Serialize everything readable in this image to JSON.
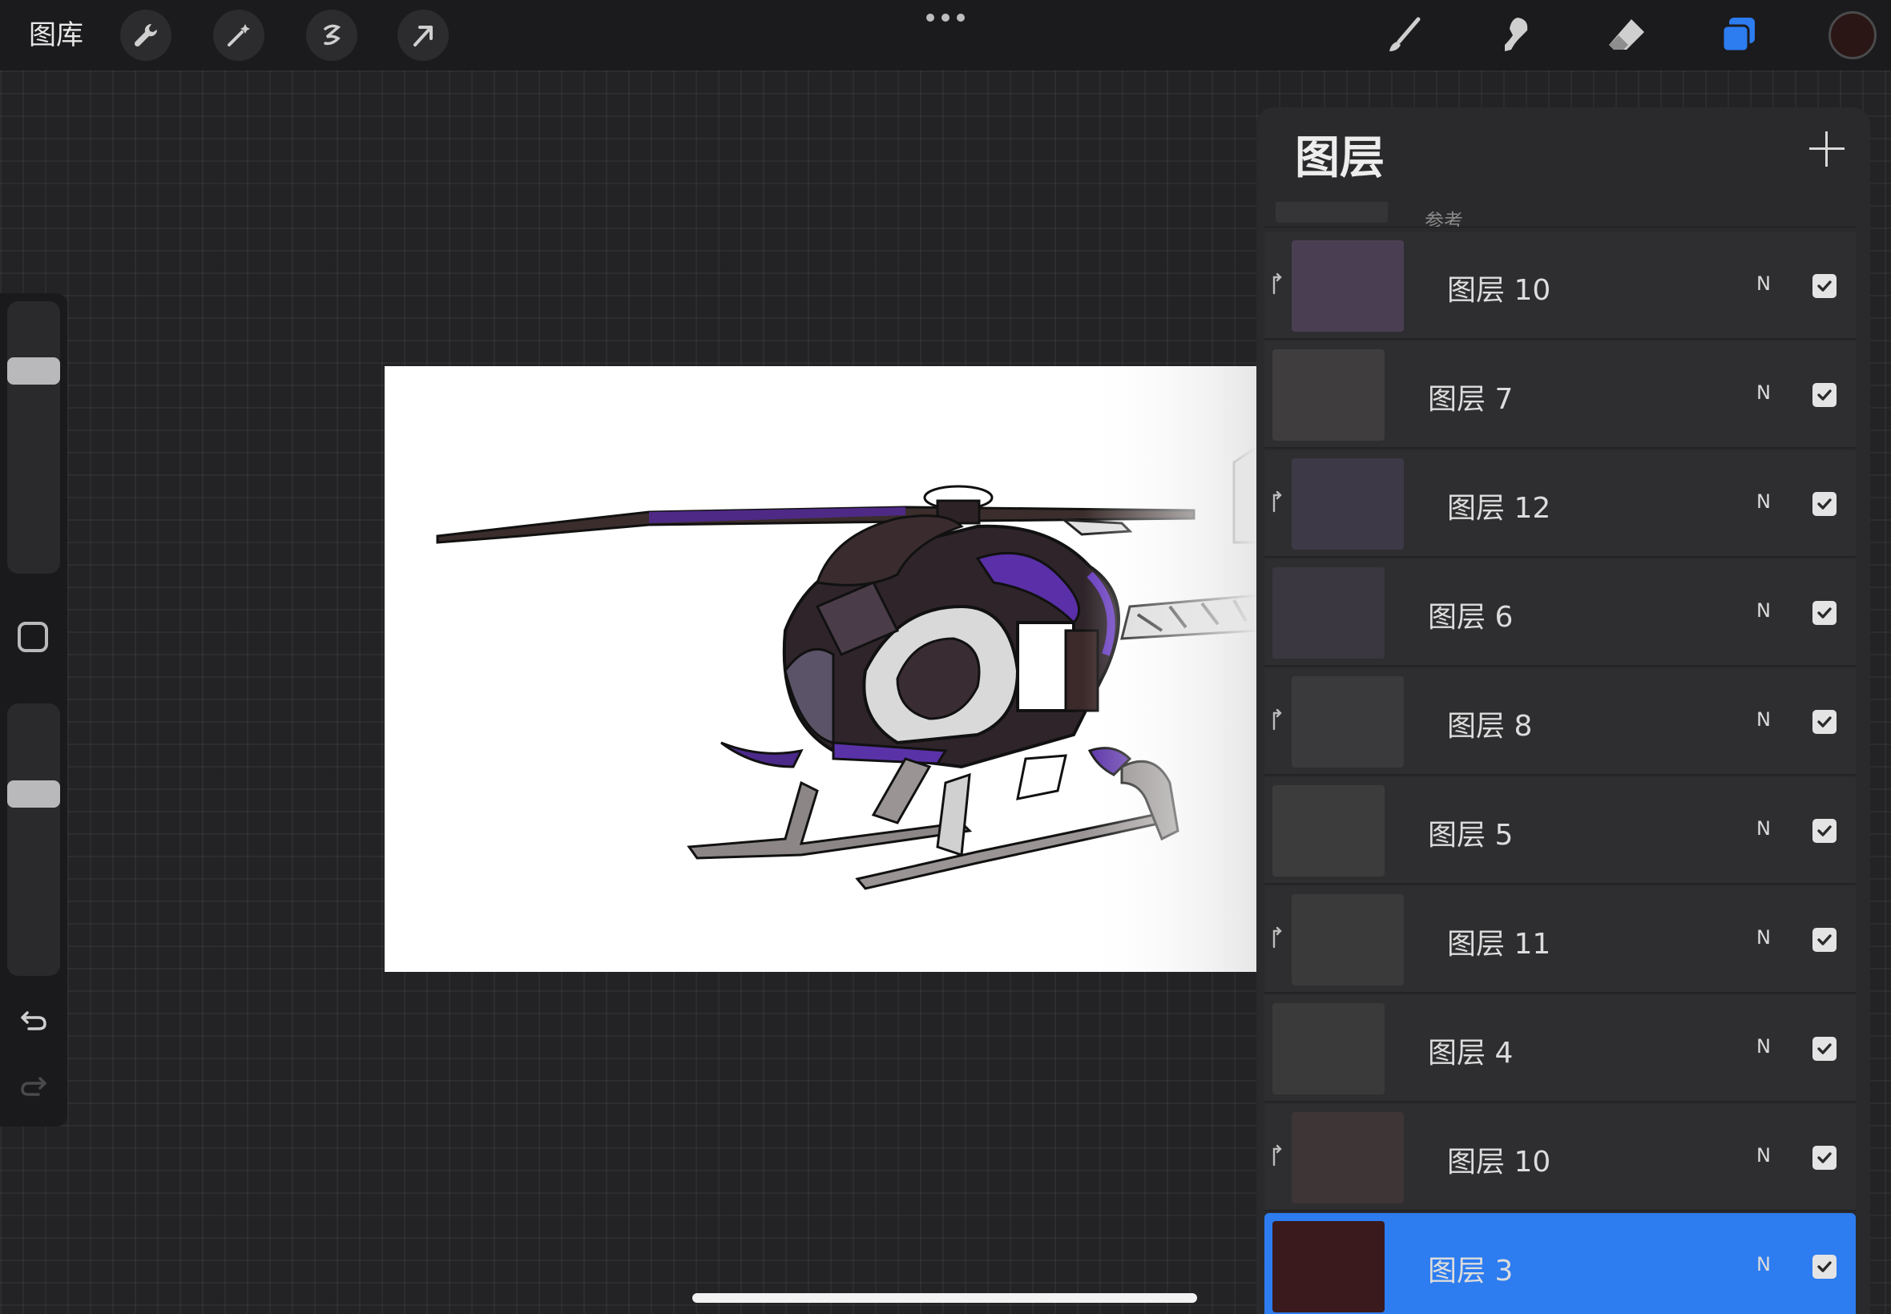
{
  "topbar": {
    "gallery_label": "图库",
    "left_tools": [
      {
        "icon": "wrench-icon"
      },
      {
        "icon": "magic-wand-icon"
      },
      {
        "icon": "selection-icon"
      },
      {
        "icon": "transform-arrow-icon"
      }
    ],
    "right_tools": [
      {
        "icon": "brush-icon"
      },
      {
        "icon": "smudge-icon"
      },
      {
        "icon": "eraser-icon"
      },
      {
        "icon": "layers-icon",
        "active": true,
        "color": "#2d7cf0"
      }
    ],
    "current_color": "#2a1614"
  },
  "sidebar": {
    "brush_size_level": 0.22,
    "opacity_level": 0.32
  },
  "layers_panel": {
    "title": "图层",
    "partial_top_label": "参考",
    "layers": [
      {
        "name": "图层 10",
        "mode": "N",
        "visible": true,
        "clipped": true
      },
      {
        "name": "图层 7",
        "mode": "N",
        "visible": true,
        "clipped": false
      },
      {
        "name": "图层 12",
        "mode": "N",
        "visible": true,
        "clipped": true
      },
      {
        "name": "图层 6",
        "mode": "N",
        "visible": true,
        "clipped": false
      },
      {
        "name": "图层 8",
        "mode": "N",
        "visible": true,
        "clipped": true
      },
      {
        "name": "图层 5",
        "mode": "N",
        "visible": true,
        "clipped": false
      },
      {
        "name": "图层 11",
        "mode": "N",
        "visible": true,
        "clipped": true
      },
      {
        "name": "图层 4",
        "mode": "N",
        "visible": true,
        "clipped": false
      },
      {
        "name": "图层 10",
        "mode": "N",
        "visible": true,
        "clipped": true
      },
      {
        "name": "图层 3",
        "mode": "N",
        "visible": true,
        "clipped": false,
        "selected": true
      }
    ],
    "accent_color": "#2d7cf0"
  }
}
